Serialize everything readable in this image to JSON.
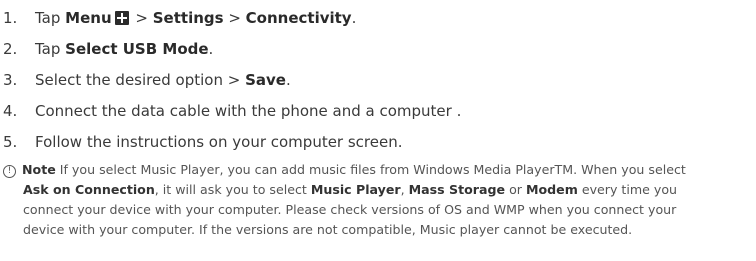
{
  "steps": [
    {
      "number": "1.",
      "parts": {
        "t1": "Tap ",
        "b1": "Menu",
        "t2": " > ",
        "b2": "Settings",
        "t3": " > ",
        "b3": "Connectivity",
        "t4": "."
      },
      "icon": "menu-grid-icon"
    },
    {
      "number": "2.",
      "parts": {
        "t1": "Tap ",
        "b1": "Select USB Mode",
        "t2": "."
      }
    },
    {
      "number": "3.",
      "parts": {
        "t1": "Select the desired option > ",
        "b1": "Save",
        "t2": "."
      }
    },
    {
      "number": "4.",
      "parts": {
        "t1": "Connect the data cable with the phone and a computer ."
      }
    },
    {
      "number": "5.",
      "parts": {
        "t1": "Follow the instructions on your computer screen."
      }
    }
  ],
  "note": {
    "icon": "info-icon",
    "icon_glyph": "!",
    "label": "Note",
    "line1": " If you select Music Player, you can add music files from Windows Media PlayerTM. When you select",
    "line2_b1": "Ask on Connection",
    "line2_t1": ", it will ask you to select ",
    "line2_b2": "Music Player",
    "line2_t2": ", ",
    "line2_b3": "Mass Storage",
    "line2_t3": " or ",
    "line2_b4": "Modem",
    "line2_t4": " every time you",
    "line3": "connect your device with your computer. Please check versions of OS and WMP when you connect your",
    "line4": "device with your computer.  If the versions are not compatible, Music player cannot be executed."
  }
}
